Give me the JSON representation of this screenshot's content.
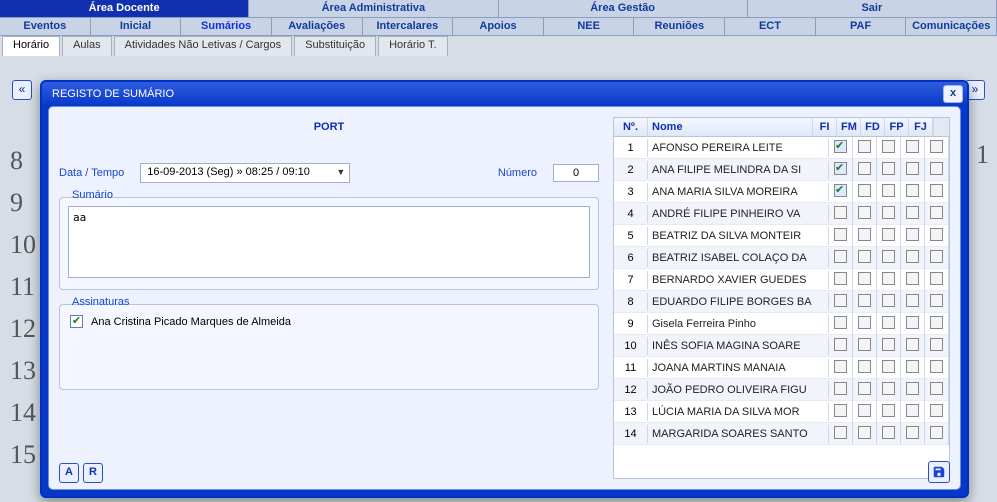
{
  "nav1": {
    "items": [
      "Área Docente",
      "Área Administrativa",
      "Área Gestão",
      "Sair"
    ],
    "active_index": 0
  },
  "nav2": {
    "items": [
      "Eventos",
      "Inicial",
      "Sumários",
      "Avaliações",
      "Intercalares",
      "Apoios",
      "NEE",
      "Reuniões",
      "ECT",
      "PAF",
      "Comunicações"
    ],
    "active_index": 2
  },
  "tabs": {
    "items": [
      "Horário",
      "Aulas",
      "Atividades Não Letivas / Cargos",
      "Substituição",
      "Horário T."
    ],
    "active_index": 0
  },
  "arrows": {
    "left": "«",
    "right": "»"
  },
  "bg": {
    "nums": [
      "8",
      "9",
      "10",
      "11",
      "12",
      "13",
      "14",
      "15"
    ],
    "right_num": "1"
  },
  "modal": {
    "title": "REGISTO DE SUMÁRIO",
    "close": "x",
    "subject": "PORT",
    "date_label": "Data / Tempo",
    "date_value": "16-09-2013 (Seg) » 08:25 / 09:10",
    "numero_label": "Número",
    "numero_value": "0",
    "sumario_label": "Sumário",
    "sumario_value": "aa",
    "assinaturas_label": "Assinaturas",
    "signature": {
      "checked": true,
      "name": "Ana Cristina Picado Marques de Almeida"
    },
    "btn_a": "A",
    "btn_r": "R"
  },
  "table": {
    "headers": {
      "n": "Nº.",
      "nome": "Nome",
      "fi": "FI",
      "fm": "FM",
      "fd": "FD",
      "fp": "FP",
      "fj": "FJ"
    },
    "rows": [
      {
        "n": 1,
        "nome": "AFONSO PEREIRA LEITE",
        "fi": true,
        "fm": false,
        "fd": false,
        "fp": false,
        "fj": false
      },
      {
        "n": 2,
        "nome": "ANA FILIPE MELINDRA DA SI",
        "fi": true,
        "fm": false,
        "fd": false,
        "fp": false,
        "fj": false
      },
      {
        "n": 3,
        "nome": "ANA MARIA SILVA MOREIRA",
        "fi": true,
        "fm": false,
        "fd": false,
        "fp": false,
        "fj": false
      },
      {
        "n": 4,
        "nome": "ANDRÉ FILIPE PINHEIRO VA",
        "fi": false,
        "fm": false,
        "fd": false,
        "fp": false,
        "fj": false
      },
      {
        "n": 5,
        "nome": "BEATRIZ DA SILVA MONTEIR",
        "fi": false,
        "fm": false,
        "fd": false,
        "fp": false,
        "fj": false
      },
      {
        "n": 6,
        "nome": "BEATRIZ ISABEL COLAÇO DA",
        "fi": false,
        "fm": false,
        "fd": false,
        "fp": false,
        "fj": false
      },
      {
        "n": 7,
        "nome": "BERNARDO XAVIER GUEDES",
        "fi": false,
        "fm": false,
        "fd": false,
        "fp": false,
        "fj": false
      },
      {
        "n": 8,
        "nome": "EDUARDO FILIPE BORGES BA",
        "fi": false,
        "fm": false,
        "fd": false,
        "fp": false,
        "fj": false
      },
      {
        "n": 9,
        "nome": "Gisela Ferreira Pinho",
        "fi": false,
        "fm": false,
        "fd": false,
        "fp": false,
        "fj": false
      },
      {
        "n": 10,
        "nome": "INÊS SOFIA MAGINA SOARE",
        "fi": false,
        "fm": false,
        "fd": false,
        "fp": false,
        "fj": false
      },
      {
        "n": 11,
        "nome": "JOANA MARTINS MANAIA",
        "fi": false,
        "fm": false,
        "fd": false,
        "fp": false,
        "fj": false
      },
      {
        "n": 12,
        "nome": "JOÃO PEDRO OLIVEIRA FIGU",
        "fi": false,
        "fm": false,
        "fd": false,
        "fp": false,
        "fj": false
      },
      {
        "n": 13,
        "nome": "LÚCIA MARIA DA SILVA MOR",
        "fi": false,
        "fm": false,
        "fd": false,
        "fp": false,
        "fj": false
      },
      {
        "n": 14,
        "nome": "MARGARIDA SOARES SANTO",
        "fi": false,
        "fm": false,
        "fd": false,
        "fp": false,
        "fj": false
      }
    ]
  }
}
